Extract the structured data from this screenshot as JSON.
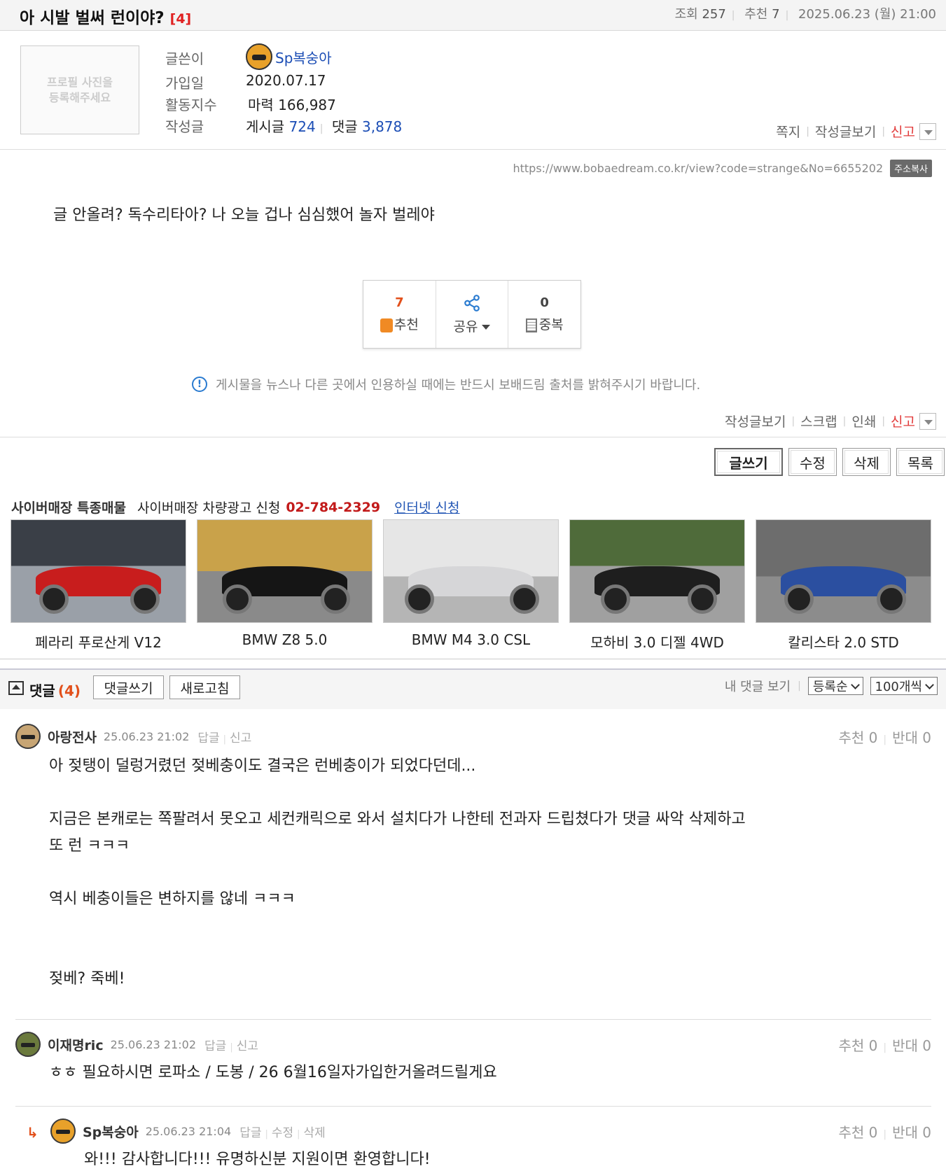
{
  "post": {
    "title": "아 시발 벌써 런이야?",
    "comment_count": "[4]",
    "views_label": "조회",
    "views": "257",
    "likes_label": "추천",
    "likes": "7",
    "datetime": "2025.06.23 (월) 21:00"
  },
  "profile": {
    "photo_placeholder": "프로필 사진을\n등록해주세요",
    "author_label": "글쓴이",
    "author": "Sp복숭아",
    "joined_label": "가입일",
    "joined": "2020.07.17",
    "activity_label": "활동지수",
    "activity": "마력 166,987",
    "posts_label": "작성글",
    "posts_text": "게시글",
    "posts_count": "724",
    "comments_text": "댓글",
    "comments_count": "3,878",
    "links": {
      "message": "쪽지",
      "view_posts": "작성글보기",
      "report": "신고"
    }
  },
  "url": {
    "text": "https://www.bobaedream.co.kr/view?code=strange&No=6655202",
    "copy_label": "주소복사"
  },
  "body": "글 안올려? 독수리타아? 나 오늘 겁나 심심했어 놀자 벌레야",
  "votes": {
    "recommend_count": "7",
    "recommend_label": "추천",
    "share_label": "공유",
    "duplicate_count": "0",
    "duplicate_label": "중복"
  },
  "notice": "게시물을 뉴스나 다른 곳에서 인용하실 때에는 반드시 보배드림 출처를 밝혀주시기 바랍니다.",
  "bottom_links": {
    "view_posts": "작성글보기",
    "scrap": "스크랩",
    "print": "인쇄",
    "report": "신고"
  },
  "buttons": {
    "write": "글쓰기",
    "edit": "수정",
    "delete": "삭제",
    "list": "목록"
  },
  "ad": {
    "title": "사이버매장 특종매물",
    "apply_text": "사이버매장 차량광고 신청",
    "phone": "02-784-2329",
    "online_apply": "인터넷 신청",
    "cars": [
      {
        "name": "페라리 푸로산게 V12",
        "color": "#c81d1d"
      },
      {
        "name": "BMW Z8 5.0",
        "color": "#151515"
      },
      {
        "name": "BMW M4 3.0 CSL",
        "color": "#d6d6d8"
      },
      {
        "name": "모하비 3.0 디젤 4WD",
        "color": "#1e1e1e"
      },
      {
        "name": "칼리스타 2.0 STD",
        "color": "#2b4fa0"
      }
    ]
  },
  "comments_bar": {
    "label": "댓글",
    "count": "(4)",
    "write_button": "댓글쓰기",
    "refresh_button": "새로고침",
    "my_comments": "내 댓글 보기",
    "sort_select": "등록순",
    "page_size_select": "100개씩"
  },
  "comments": [
    {
      "author": "아랑전사",
      "date": "25.06.23 21:02",
      "actions": [
        "답글",
        "신고"
      ],
      "recommend": "추천 0",
      "oppose": "반대 0",
      "lines": [
        "아 젖탱이 덜렁거렸던 젖베충이도 결국은 런베충이가 되었다던데...",
        "",
        "지금은 본캐로는 쪽팔려서 못오고 세컨캐릭으로 와서 설치다가 나한테 전과자 드립쳤다가 댓글 싸악 삭제하고",
        "또 런 ㅋㅋㅋ",
        "",
        "역시 베충이들은 변하지를 않네 ㅋㅋㅋ",
        "",
        "",
        "젖베? 죽베!"
      ]
    },
    {
      "author": "이재명ric",
      "date": "25.06.23 21:02",
      "actions": [
        "답글",
        "신고"
      ],
      "recommend": "추천 0",
      "oppose": "반대 0",
      "lines": [
        "ㅎㅎ 필요하시면 로파소 / 도봉 / 26 6월16일자가입한거올려드릴게요"
      ]
    },
    {
      "author": "Sp복숭아",
      "date": "25.06.23 21:04",
      "actions": [
        "답글",
        "수정",
        "삭제"
      ],
      "recommend": "추천 0",
      "oppose": "반대 0",
      "lines": [
        "와!!! 감사합니다!!! 유명하신분 지원이면 환영합니다!"
      ]
    }
  ]
}
